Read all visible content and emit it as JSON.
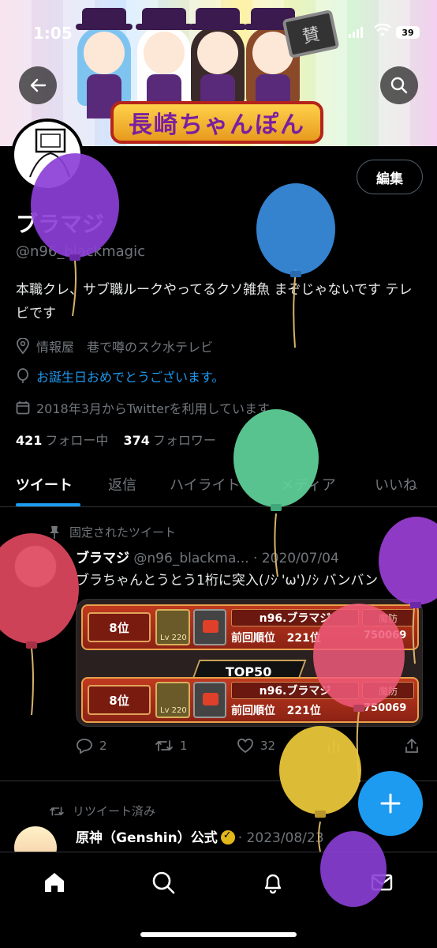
{
  "status_bar": {
    "time": "1:05",
    "battery": "39"
  },
  "banner": {
    "title": "長崎ちゃんぽん",
    "tv_label": "賛"
  },
  "profile": {
    "name": "ブラマジ",
    "handle": "@n96_blackmagic",
    "bio": "本職クレ、サブ職ルークやってるクソ雑魚 まぞじゃないです テレビです",
    "location": "情報屋　巷で噂のスク水テレビ",
    "birthday": "お誕生日おめでとうございます。",
    "joined": "2018年3月からTwitterを利用しています",
    "following_count": "421",
    "following_label": "フォロー中",
    "followers_count": "374",
    "followers_label": "フォロワー",
    "edit_label": "編集"
  },
  "tabs": [
    {
      "label": "ツイート"
    },
    {
      "label": "返信"
    },
    {
      "label": "ハイライト"
    },
    {
      "label": "メディア"
    },
    {
      "label": "いいね"
    }
  ],
  "pinned_tweet": {
    "pinned_label": "固定されたツイート",
    "name": "ブラマジ",
    "handle_date": "@n96_blackma... · 2020/07/04",
    "text": "ブラちゃんとうとう1桁に突入(ﾉｼ 'ω')ﾉｼ バンバン",
    "media": {
      "cards": [
        {
          "rank": "8位",
          "level": "Lv 220",
          "name": "n96.ブラマジ",
          "prev_label": "前回順位",
          "prev_rank": "221位",
          "type": "魔防",
          "score": "750069"
        },
        {
          "rank": "8位",
          "level": "Lv 220",
          "name": "n96.ブラマジ",
          "prev_label": "前回順位",
          "prev_rank": "221位",
          "type": "魔防",
          "score": "750069"
        }
      ],
      "band": "TOP50"
    },
    "replies": "2",
    "retweets": "1",
    "likes": "32"
  },
  "retweet": {
    "note": "リツイート済み",
    "name": "原神（Genshin）公式",
    "date": "· 2023/08/23"
  },
  "colors": {
    "accent": "#1d9bf0",
    "background": "#000000",
    "secondary_text": "#71767b",
    "balloon_purple": "#8b3fd6",
    "balloon_blue": "#3a8de0",
    "balloon_green": "#5fd49a",
    "balloon_red": "#e0485f",
    "balloon_pink": "#f05a7a",
    "balloon_yellow": "#e8c53a"
  },
  "icons": [
    "back-arrow-icon",
    "search-icon",
    "location-icon",
    "balloon-icon",
    "calendar-icon",
    "pin-icon",
    "reply-icon",
    "retweet-icon",
    "like-icon",
    "views-icon",
    "share-icon",
    "compose-plus-icon",
    "home-icon",
    "notifications-icon",
    "messages-icon"
  ]
}
